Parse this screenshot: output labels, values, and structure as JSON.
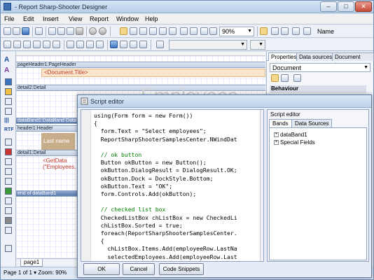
{
  "window": {
    "title": "- Report Sharp-Shooter Designer"
  },
  "menu": [
    "File",
    "Edit",
    "Insert",
    "View",
    "Report",
    "Window",
    "Help"
  ],
  "toolbar": {
    "zoom": "90%",
    "name_label": "Name"
  },
  "designer": {
    "bands": [
      {
        "label": "pageHeader1:PageHeader"
      },
      {
        "label": "detail2:Detail"
      },
      {
        "label": "dataBand1:DataBand DataS"
      },
      {
        "label": "header1:Header"
      },
      {
        "label": "detail1:Detail"
      },
      {
        "label": "end of dataBand1"
      }
    ],
    "doc_title": "<Document.Title>",
    "last_name": "Last name",
    "getdata": "<GetData\n(\"Employees.",
    "page_tab": "page1",
    "background_text": "Employees"
  },
  "right_panel": {
    "tabs": [
      "Properties",
      "Data sources",
      "Document tree"
    ],
    "combo": "Document",
    "section": "Behaviour"
  },
  "dialog": {
    "title": "Script editor",
    "right_title": "Script editor",
    "tabs": [
      "Bands",
      "Data Sources"
    ],
    "tree": [
      "dataBand1",
      "Special Fields"
    ],
    "buttons": {
      "ok": "OK",
      "cancel": "Cancel",
      "snippets": "Code Snippets"
    },
    "code": [
      "using(Form form = new Form())",
      "{",
      "  form.Text = \"Select employees\";",
      "  ReportSharpShooterSamplesCenter.NWindDat",
      "",
      "  // ok button",
      "  Button okButton = new Button();",
      "  okButton.DialogResult = DialogResult.OK;",
      "  okButton.Dock = DockStyle.Bottom;",
      "  okButton.Text = \"OK\";",
      "  form.Controls.Add(okButton);",
      "",
      "  // checked list box",
      "  CheckedListBox chListBox = new CheckedLi",
      "  chListBox.Sorted = true;",
      "  foreach(ReportSharpShooterSamplesCenter.",
      "  {",
      "    chListBox.Items.Add(employeeRow.LastNa",
      "    selectedEmployees.Add(employeeRow.Last"
    ]
  },
  "status": {
    "text": "Page 1 of 1 ▾  Zoom: 90%"
  }
}
